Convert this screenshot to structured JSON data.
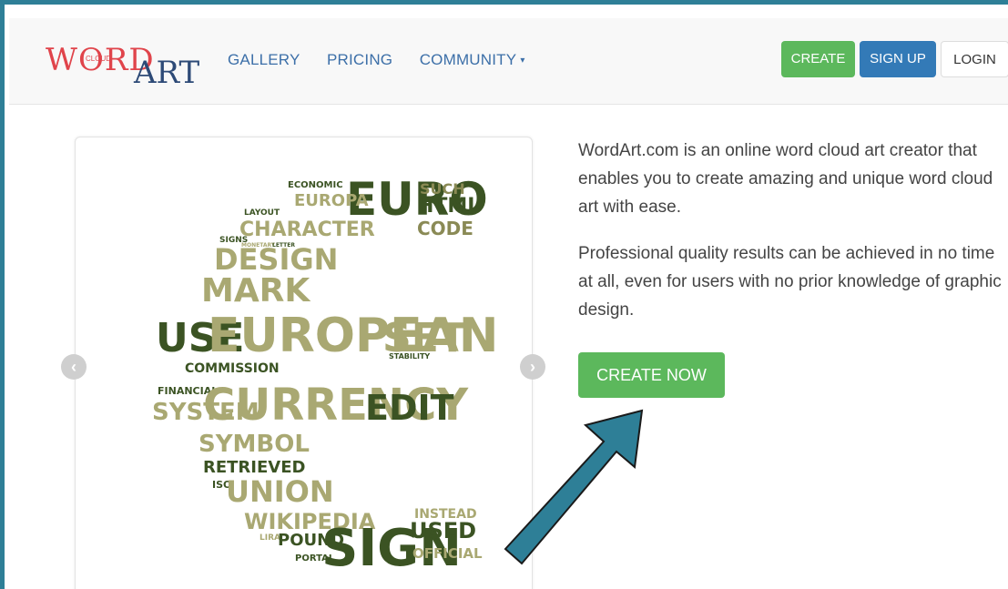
{
  "logo": {
    "word": "WORD",
    "cloud": "CLOUD",
    "art": "ART"
  },
  "nav": {
    "gallery": "GALLERY",
    "pricing": "PRICING",
    "community": "COMMUNITY",
    "caret": "▾"
  },
  "header_buttons": {
    "create": "CREATE",
    "signup": "SIGN UP",
    "login": "LOGIN"
  },
  "description": {
    "paragraph1": "WordArt.com is an online word cloud art creator that enables you to create amazing and unique word cloud art with ease.",
    "paragraph2": "Professional quality results can be achieved in no time at all, even for users with no prior knowledge of graphic design."
  },
  "cta": {
    "create_now": "CREATE NOW"
  },
  "carousel": {
    "prev_icon": "chevron-left-icon",
    "next_icon": "chevron-right-icon",
    "prev_glyph": "‹",
    "next_glyph": "›"
  },
  "word_cloud": {
    "words": [
      "ECONOMIC",
      "EURO",
      "SUCH",
      "HTML",
      "EUROPA",
      "LAYOUT",
      "CHARACTER",
      "CODE",
      "SIGNS",
      "MONETARY",
      "LETTER",
      "DESIGN",
      "MARK",
      "USE",
      "EUROPEAN",
      "SET",
      "STABILITY",
      "COMMISSION",
      "FINANCIAL",
      "SYSTEM",
      "CURRENCY",
      "EDIT",
      "SYMBOL",
      "RETRIEVED",
      "ISO",
      "UNION",
      "WIKIPEDIA",
      "LIRA",
      "POUND",
      "SIGN",
      "USED",
      "OFFICIAL",
      "PORTAL",
      "INSTEAD"
    ]
  },
  "colors": {
    "frame": "#2e7f97",
    "green": "#5cb85c",
    "blue": "#337ab7",
    "nav_link": "#3c6fa8",
    "logo_red": "#e0444b",
    "logo_navy": "#2d4a77",
    "cloud_dark": "#3b5323",
    "cloud_olive": "#8a8a55",
    "cloud_khaki": "#a9a872",
    "arrow": "#2e7f97"
  }
}
